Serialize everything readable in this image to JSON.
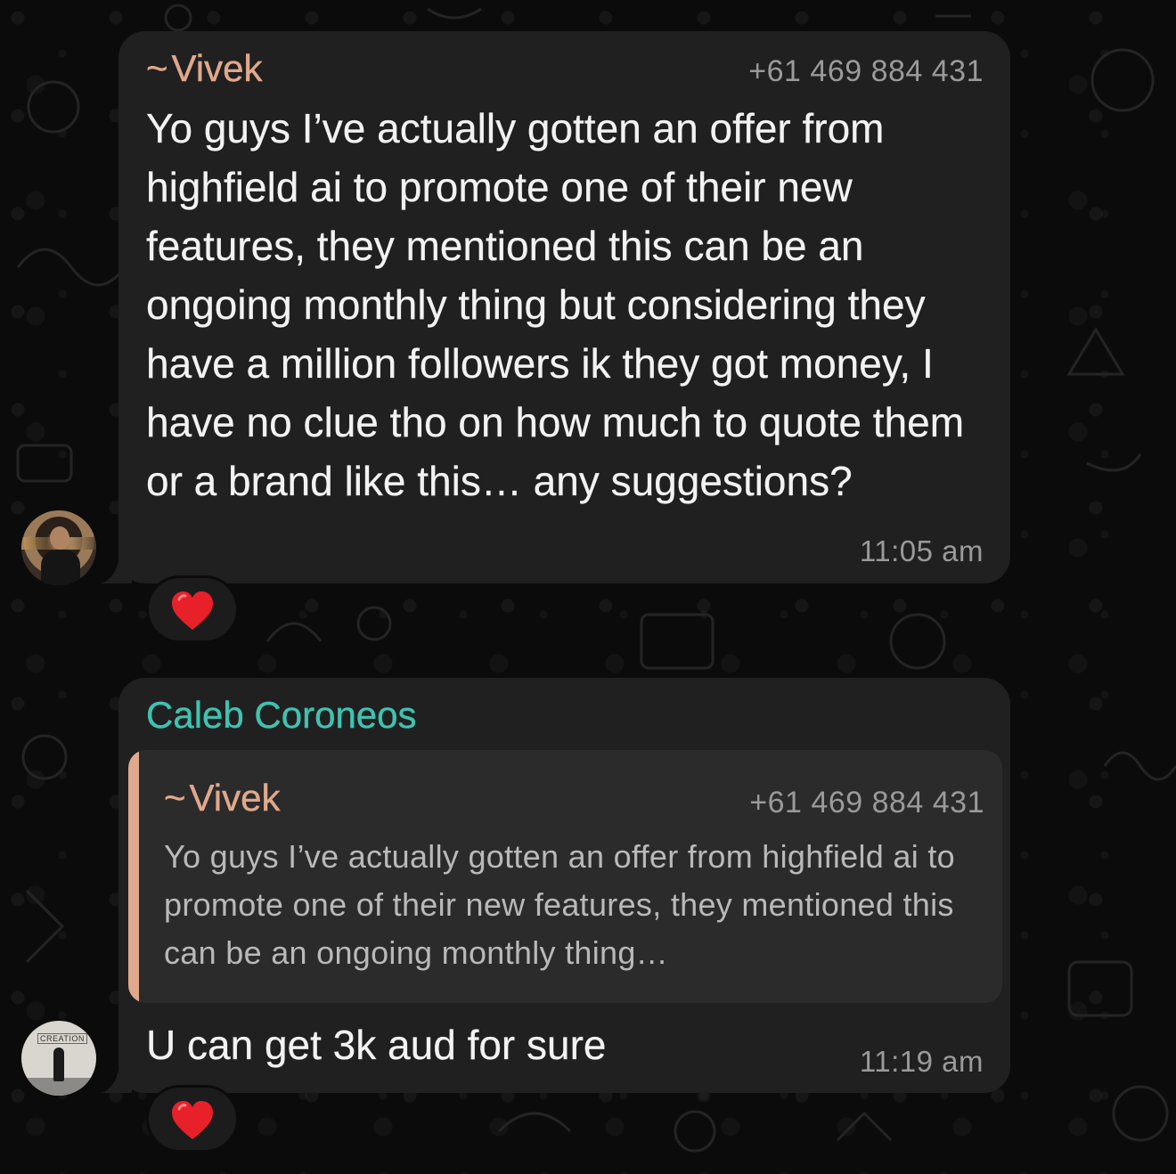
{
  "chat": {
    "messages": [
      {
        "sender_prefix": "~",
        "sender": "Vivek",
        "phone": "+61 469 884 431",
        "text": "Yo guys I’ve actually gotten an offer from highfield ai to promote one of their new features, they mentioned this can be an ongoing monthly thing but considering they have a million followers ik they got money, I have no clue tho on how much to quote them or a brand like this… any suggestions?",
        "time": "11:05 am",
        "reaction": "heart-icon"
      },
      {
        "sender": "Caleb Coroneos",
        "quoted": {
          "sender_prefix": "~",
          "sender": "Vivek",
          "phone": "+61 469 884 431",
          "text": "Yo guys I’ve actually gotten an offer from highfield ai to promote one of their new features, they mentioned this can be an ongoing monthly thing…"
        },
        "text": "U can get 3k aud for sure",
        "time": "11:19 am",
        "reaction": "heart-icon"
      }
    ],
    "avatar_2_text": "CREATION"
  },
  "colors": {
    "background": "#0b0b0b",
    "bubble": "#202020",
    "quote_background": "#2b2b2b",
    "vivek_name": "#e0a88c",
    "caleb_name": "#3fc3b0",
    "meta_text": "#9a9a9a",
    "heart": "#e8202a"
  }
}
